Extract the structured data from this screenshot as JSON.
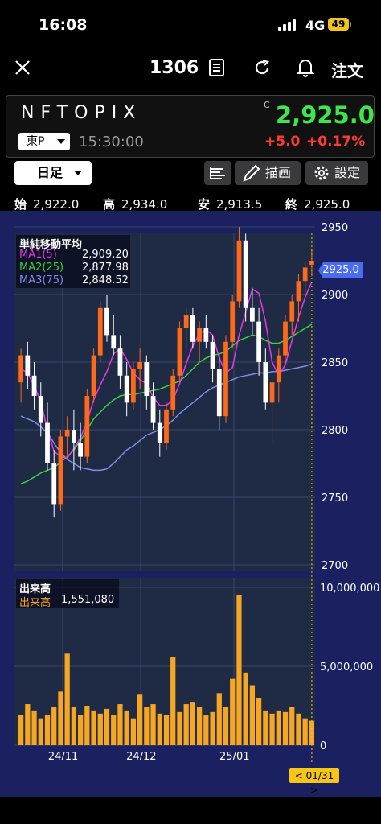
{
  "status_bar": {
    "time": "16:08",
    "network": "4G",
    "battery": "49"
  },
  "nav": {
    "title": "1306",
    "order_label": "注文"
  },
  "quote": {
    "name": "NFTOPIX",
    "market": "東P",
    "time": "15:30:00",
    "mark": "C",
    "price": "2,925.0",
    "change": "+5.0",
    "change_pct": "+0.17%"
  },
  "toolbar": {
    "period": "日足",
    "draw_label": "描画",
    "settings_label": "設定"
  },
  "ohlc": {
    "open_label": "始",
    "open": "2,922.0",
    "high_label": "高",
    "high": "2,934.0",
    "low_label": "安",
    "low": "2,913.5",
    "close_label": "終",
    "close": "2,925.0"
  },
  "price_legend": {
    "title": "単純移動平均",
    "items": [
      {
        "label": "MA1(5)",
        "value": "2,909.20",
        "color": "#e838e8"
      },
      {
        "label": "MA2(25)",
        "value": "2,877.98",
        "color": "#3ad43a"
      },
      {
        "label": "MA3(75)",
        "value": "2,848.52",
        "color": "#7f8fe8"
      }
    ]
  },
  "volume_legend": {
    "title": "出来高",
    "label": "出来高",
    "value": "1,551,080"
  },
  "price_marker": "2925.0",
  "date_marker": "< 01/31 >",
  "colors": {
    "up": "#ff6a1a",
    "down": "#ffffff",
    "bg": "#1a2060",
    "panel": "#1f2a45",
    "volume": "#f5a623",
    "price_up": "#3fe54a",
    "change": "#ff3b30"
  },
  "chart_data": {
    "type": "candlestick",
    "price_axis": {
      "ticks": [
        "2950",
        "2900",
        "2850",
        "2800",
        "2750",
        "2700"
      ],
      "ylim": [
        2700,
        2950
      ]
    },
    "volume_axis": {
      "ticks": [
        "10,000,000",
        "5,000,000",
        "0"
      ],
      "ylim": [
        0,
        10000000
      ]
    },
    "x_ticks": [
      "24/11",
      "24/12",
      "25/01"
    ],
    "candles": [
      [
        2835,
        2860,
        2820,
        2855
      ],
      [
        2855,
        2865,
        2830,
        2840
      ],
      [
        2840,
        2850,
        2815,
        2825
      ],
      [
        2825,
        2835,
        2795,
        2805
      ],
      [
        2805,
        2820,
        2770,
        2775
      ],
      [
        2775,
        2785,
        2735,
        2745
      ],
      [
        2745,
        2800,
        2740,
        2795
      ],
      [
        2795,
        2810,
        2780,
        2800
      ],
      [
        2800,
        2815,
        2770,
        2790
      ],
      [
        2790,
        2805,
        2770,
        2780
      ],
      [
        2780,
        2830,
        2775,
        2825
      ],
      [
        2825,
        2860,
        2820,
        2855
      ],
      [
        2855,
        2895,
        2850,
        2890
      ],
      [
        2890,
        2900,
        2865,
        2870
      ],
      [
        2870,
        2885,
        2855,
        2860
      ],
      [
        2860,
        2870,
        2830,
        2840
      ],
      [
        2840,
        2850,
        2810,
        2820
      ],
      [
        2820,
        2850,
        2815,
        2845
      ],
      [
        2845,
        2860,
        2830,
        2850
      ],
      [
        2850,
        2855,
        2815,
        2825
      ],
      [
        2825,
        2835,
        2800,
        2805
      ],
      [
        2805,
        2815,
        2780,
        2790
      ],
      [
        2790,
        2820,
        2785,
        2815
      ],
      [
        2815,
        2845,
        2810,
        2840
      ],
      [
        2840,
        2880,
        2835,
        2875
      ],
      [
        2875,
        2890,
        2860,
        2885
      ],
      [
        2885,
        2890,
        2860,
        2865
      ],
      [
        2865,
        2880,
        2850,
        2875
      ],
      [
        2875,
        2885,
        2860,
        2865
      ],
      [
        2865,
        2870,
        2835,
        2845
      ],
      [
        2845,
        2855,
        2800,
        2810
      ],
      [
        2810,
        2870,
        2805,
        2865
      ],
      [
        2865,
        2900,
        2860,
        2895
      ],
      [
        2895,
        2950,
        2890,
        2940
      ],
      [
        2940,
        2945,
        2880,
        2890
      ],
      [
        2890,
        2905,
        2870,
        2880
      ],
      [
        2880,
        2890,
        2840,
        2850
      ],
      [
        2850,
        2860,
        2815,
        2820
      ],
      [
        2820,
        2830,
        2790,
        2835
      ],
      [
        2835,
        2860,
        2820,
        2855
      ],
      [
        2855,
        2885,
        2850,
        2880
      ],
      [
        2880,
        2900,
        2870,
        2895
      ],
      [
        2895,
        2915,
        2880,
        2910
      ],
      [
        2910,
        2925,
        2900,
        2920
      ],
      [
        2922,
        2934,
        2913.5,
        2925
      ]
    ],
    "volume_millions": [
      1.9,
      2.6,
      2.2,
      1.7,
      1.9,
      2.4,
      3.4,
      5.8,
      2.4,
      1.9,
      2.5,
      2.2,
      2.0,
      2.3,
      1.9,
      2.6,
      2.2,
      1.7,
      3.2,
      2.4,
      2.6,
      2.0,
      1.9,
      5.6,
      2.1,
      2.6,
      2.7,
      2.4,
      1.9,
      2.1,
      3.3,
      2.4,
      4.2,
      9.5,
      4.6,
      3.8,
      3.0,
      2.2,
      2.0,
      2.2,
      2.1,
      2.4,
      2.0,
      1.7,
      1.55
    ],
    "ma1": [
      2845,
      2842,
      2832,
      2821,
      2800,
      2784,
      2780,
      2779,
      2786,
      2794,
      2806,
      2822,
      2833,
      2843,
      2856,
      2860,
      2852,
      2842,
      2837,
      2834,
      2824,
      2818,
      2818,
      2822,
      2834,
      2849,
      2862,
      2871,
      2874,
      2870,
      2853,
      2842,
      2846,
      2870,
      2887,
      2904,
      2901,
      2880,
      2850,
      2840,
      2848,
      2866,
      2883,
      2898,
      2909.2
    ],
    "ma2": [
      2760,
      2762,
      2765,
      2768,
      2770,
      2772,
      2776,
      2780,
      2785,
      2792,
      2800,
      2808,
      2813,
      2818,
      2822,
      2825,
      2826,
      2826,
      2827,
      2828,
      2829,
      2830,
      2832,
      2834,
      2836,
      2840,
      2845,
      2850,
      2853,
      2855,
      2856,
      2858,
      2862,
      2866,
      2868,
      2870,
      2869,
      2866,
      2864,
      2864,
      2866,
      2869,
      2872,
      2875,
      2877.98
    ],
    "ma3": [
      2810,
      2808,
      2806,
      2802,
      2798,
      2790,
      2783,
      2778,
      2775,
      2772,
      2771,
      2770,
      2770,
      2771,
      2775,
      2780,
      2785,
      2788,
      2792,
      2796,
      2798,
      2800,
      2803,
      2807,
      2812,
      2816,
      2820,
      2824,
      2828,
      2831,
      2833,
      2835,
      2837,
      2839,
      2840,
      2841,
      2842,
      2842,
      2843,
      2843,
      2844,
      2845,
      2846,
      2847,
      2848.52
    ]
  }
}
